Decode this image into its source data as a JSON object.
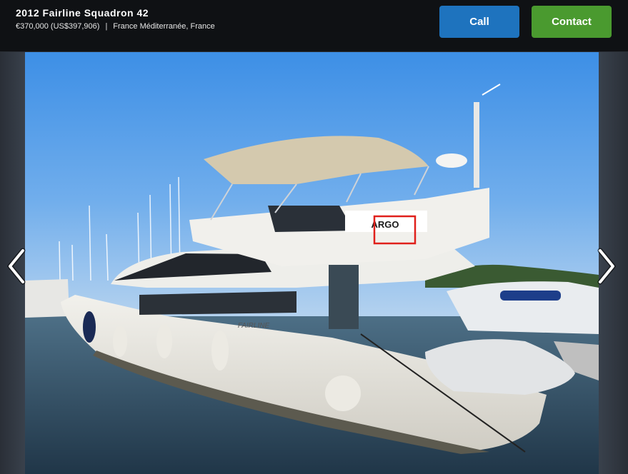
{
  "listing": {
    "title": "2012 Fairline Squadron 42",
    "price": "€370,000 (US$397,906)",
    "separator": "|",
    "location": "France Méditerranée, France"
  },
  "actions": {
    "call_label": "Call",
    "contact_label": "Contact"
  },
  "gallery": {
    "boat_name_on_hull": "ARGO",
    "hull_brand": "FAIRLINE",
    "prev_icon": "chevron-left-icon",
    "next_icon": "chevron-right-icon"
  },
  "colors": {
    "topbar": "#0f1114",
    "call_button": "#1e73be",
    "contact_button": "#4a9a2f",
    "highlight_box": "#e0201b"
  }
}
